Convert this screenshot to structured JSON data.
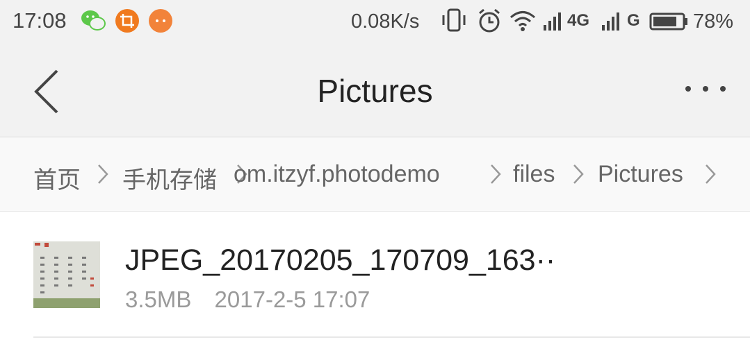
{
  "status_bar": {
    "time": "17:08",
    "net_speed": "0.08K/s",
    "net_label_1": "4G",
    "net_label_2": "G",
    "battery": "78%",
    "apps": [
      "wechat-icon",
      "crop-app-icon",
      "chat-app-icon"
    ]
  },
  "header": {
    "title": "Pictures",
    "back_icon": "chevron-left-icon",
    "more_icon": "more-horizontal-icon"
  },
  "breadcrumb": [
    "首页",
    "手机存储",
    "om.itzyf.photodemo",
    "files",
    "Pictures"
  ],
  "files": [
    {
      "name": "JPEG_20170205_170709_163··",
      "size": "3.5MB",
      "date": "2017-2-5 17:07"
    }
  ],
  "colors": {
    "bar_bg": "#f2f2f2",
    "crumb_text": "#666666",
    "meta_text": "#9a9a9a"
  }
}
